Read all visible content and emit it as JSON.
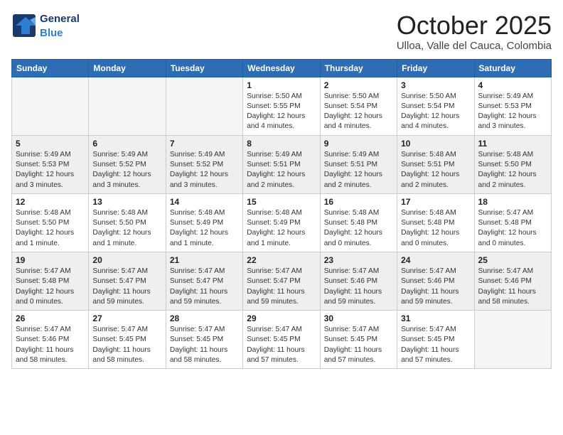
{
  "header": {
    "logo_general": "General",
    "logo_blue": "Blue",
    "month": "October 2025",
    "location": "Ulloa, Valle del Cauca, Colombia"
  },
  "weekdays": [
    "Sunday",
    "Monday",
    "Tuesday",
    "Wednesday",
    "Thursday",
    "Friday",
    "Saturday"
  ],
  "weeks": [
    {
      "days": [
        {
          "num": "",
          "info": "",
          "empty": true
        },
        {
          "num": "",
          "info": "",
          "empty": true
        },
        {
          "num": "",
          "info": "",
          "empty": true
        },
        {
          "num": "1",
          "info": "Sunrise: 5:50 AM\nSunset: 5:55 PM\nDaylight: 12 hours\nand 4 minutes.",
          "empty": false
        },
        {
          "num": "2",
          "info": "Sunrise: 5:50 AM\nSunset: 5:54 PM\nDaylight: 12 hours\nand 4 minutes.",
          "empty": false
        },
        {
          "num": "3",
          "info": "Sunrise: 5:50 AM\nSunset: 5:54 PM\nDaylight: 12 hours\nand 4 minutes.",
          "empty": false
        },
        {
          "num": "4",
          "info": "Sunrise: 5:49 AM\nSunset: 5:53 PM\nDaylight: 12 hours\nand 3 minutes.",
          "empty": false
        }
      ]
    },
    {
      "days": [
        {
          "num": "5",
          "info": "Sunrise: 5:49 AM\nSunset: 5:53 PM\nDaylight: 12 hours\nand 3 minutes.",
          "empty": false
        },
        {
          "num": "6",
          "info": "Sunrise: 5:49 AM\nSunset: 5:52 PM\nDaylight: 12 hours\nand 3 minutes.",
          "empty": false
        },
        {
          "num": "7",
          "info": "Sunrise: 5:49 AM\nSunset: 5:52 PM\nDaylight: 12 hours\nand 3 minutes.",
          "empty": false
        },
        {
          "num": "8",
          "info": "Sunrise: 5:49 AM\nSunset: 5:51 PM\nDaylight: 12 hours\nand 2 minutes.",
          "empty": false
        },
        {
          "num": "9",
          "info": "Sunrise: 5:49 AM\nSunset: 5:51 PM\nDaylight: 12 hours\nand 2 minutes.",
          "empty": false
        },
        {
          "num": "10",
          "info": "Sunrise: 5:48 AM\nSunset: 5:51 PM\nDaylight: 12 hours\nand 2 minutes.",
          "empty": false
        },
        {
          "num": "11",
          "info": "Sunrise: 5:48 AM\nSunset: 5:50 PM\nDaylight: 12 hours\nand 2 minutes.",
          "empty": false
        }
      ]
    },
    {
      "days": [
        {
          "num": "12",
          "info": "Sunrise: 5:48 AM\nSunset: 5:50 PM\nDaylight: 12 hours\nand 1 minute.",
          "empty": false
        },
        {
          "num": "13",
          "info": "Sunrise: 5:48 AM\nSunset: 5:50 PM\nDaylight: 12 hours\nand 1 minute.",
          "empty": false
        },
        {
          "num": "14",
          "info": "Sunrise: 5:48 AM\nSunset: 5:49 PM\nDaylight: 12 hours\nand 1 minute.",
          "empty": false
        },
        {
          "num": "15",
          "info": "Sunrise: 5:48 AM\nSunset: 5:49 PM\nDaylight: 12 hours\nand 1 minute.",
          "empty": false
        },
        {
          "num": "16",
          "info": "Sunrise: 5:48 AM\nSunset: 5:48 PM\nDaylight: 12 hours\nand 0 minutes.",
          "empty": false
        },
        {
          "num": "17",
          "info": "Sunrise: 5:48 AM\nSunset: 5:48 PM\nDaylight: 12 hours\nand 0 minutes.",
          "empty": false
        },
        {
          "num": "18",
          "info": "Sunrise: 5:47 AM\nSunset: 5:48 PM\nDaylight: 12 hours\nand 0 minutes.",
          "empty": false
        }
      ]
    },
    {
      "days": [
        {
          "num": "19",
          "info": "Sunrise: 5:47 AM\nSunset: 5:48 PM\nDaylight: 12 hours\nand 0 minutes.",
          "empty": false
        },
        {
          "num": "20",
          "info": "Sunrise: 5:47 AM\nSunset: 5:47 PM\nDaylight: 11 hours\nand 59 minutes.",
          "empty": false
        },
        {
          "num": "21",
          "info": "Sunrise: 5:47 AM\nSunset: 5:47 PM\nDaylight: 11 hours\nand 59 minutes.",
          "empty": false
        },
        {
          "num": "22",
          "info": "Sunrise: 5:47 AM\nSunset: 5:47 PM\nDaylight: 11 hours\nand 59 minutes.",
          "empty": false
        },
        {
          "num": "23",
          "info": "Sunrise: 5:47 AM\nSunset: 5:46 PM\nDaylight: 11 hours\nand 59 minutes.",
          "empty": false
        },
        {
          "num": "24",
          "info": "Sunrise: 5:47 AM\nSunset: 5:46 PM\nDaylight: 11 hours\nand 59 minutes.",
          "empty": false
        },
        {
          "num": "25",
          "info": "Sunrise: 5:47 AM\nSunset: 5:46 PM\nDaylight: 11 hours\nand 58 minutes.",
          "empty": false
        }
      ]
    },
    {
      "days": [
        {
          "num": "26",
          "info": "Sunrise: 5:47 AM\nSunset: 5:46 PM\nDaylight: 11 hours\nand 58 minutes.",
          "empty": false
        },
        {
          "num": "27",
          "info": "Sunrise: 5:47 AM\nSunset: 5:45 PM\nDaylight: 11 hours\nand 58 minutes.",
          "empty": false
        },
        {
          "num": "28",
          "info": "Sunrise: 5:47 AM\nSunset: 5:45 PM\nDaylight: 11 hours\nand 58 minutes.",
          "empty": false
        },
        {
          "num": "29",
          "info": "Sunrise: 5:47 AM\nSunset: 5:45 PM\nDaylight: 11 hours\nand 57 minutes.",
          "empty": false
        },
        {
          "num": "30",
          "info": "Sunrise: 5:47 AM\nSunset: 5:45 PM\nDaylight: 11 hours\nand 57 minutes.",
          "empty": false
        },
        {
          "num": "31",
          "info": "Sunrise: 5:47 AM\nSunset: 5:45 PM\nDaylight: 11 hours\nand 57 minutes.",
          "empty": false
        },
        {
          "num": "",
          "info": "",
          "empty": true
        }
      ]
    }
  ]
}
